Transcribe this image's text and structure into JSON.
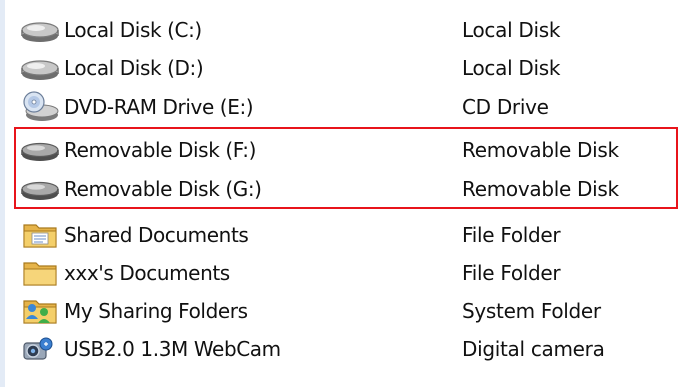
{
  "rows": [
    {
      "name": "Local Disk (C:)",
      "type": "Local Disk",
      "icon": "hard-drive-icon"
    },
    {
      "name": "Local Disk (D:)",
      "type": "Local Disk",
      "icon": "hard-drive-icon"
    },
    {
      "name": "DVD-RAM Drive (E:)",
      "type": "CD Drive",
      "icon": "dvd-drive-icon"
    },
    {
      "name": "Removable Disk (F:)",
      "type": "Removable Disk",
      "icon": "removable-disk-icon"
    },
    {
      "name": "Removable Disk (G:)",
      "type": "Removable Disk",
      "icon": "removable-disk-icon"
    },
    {
      "name": "Shared Documents",
      "type": "File Folder",
      "icon": "shared-folder-icon"
    },
    {
      "name": "xxx's Documents",
      "type": "File Folder",
      "icon": "folder-icon"
    },
    {
      "name": "My Sharing Folders",
      "type": "System Folder",
      "icon": "sharing-folder-icon"
    },
    {
      "name": "USB2.0 1.3M WebCam",
      "type": "Digital camera",
      "icon": "webcam-icon"
    }
  ],
  "colors": {
    "highlight_border": "#e8141b",
    "text": "#111111",
    "left_edge": "#e3ebf6"
  }
}
